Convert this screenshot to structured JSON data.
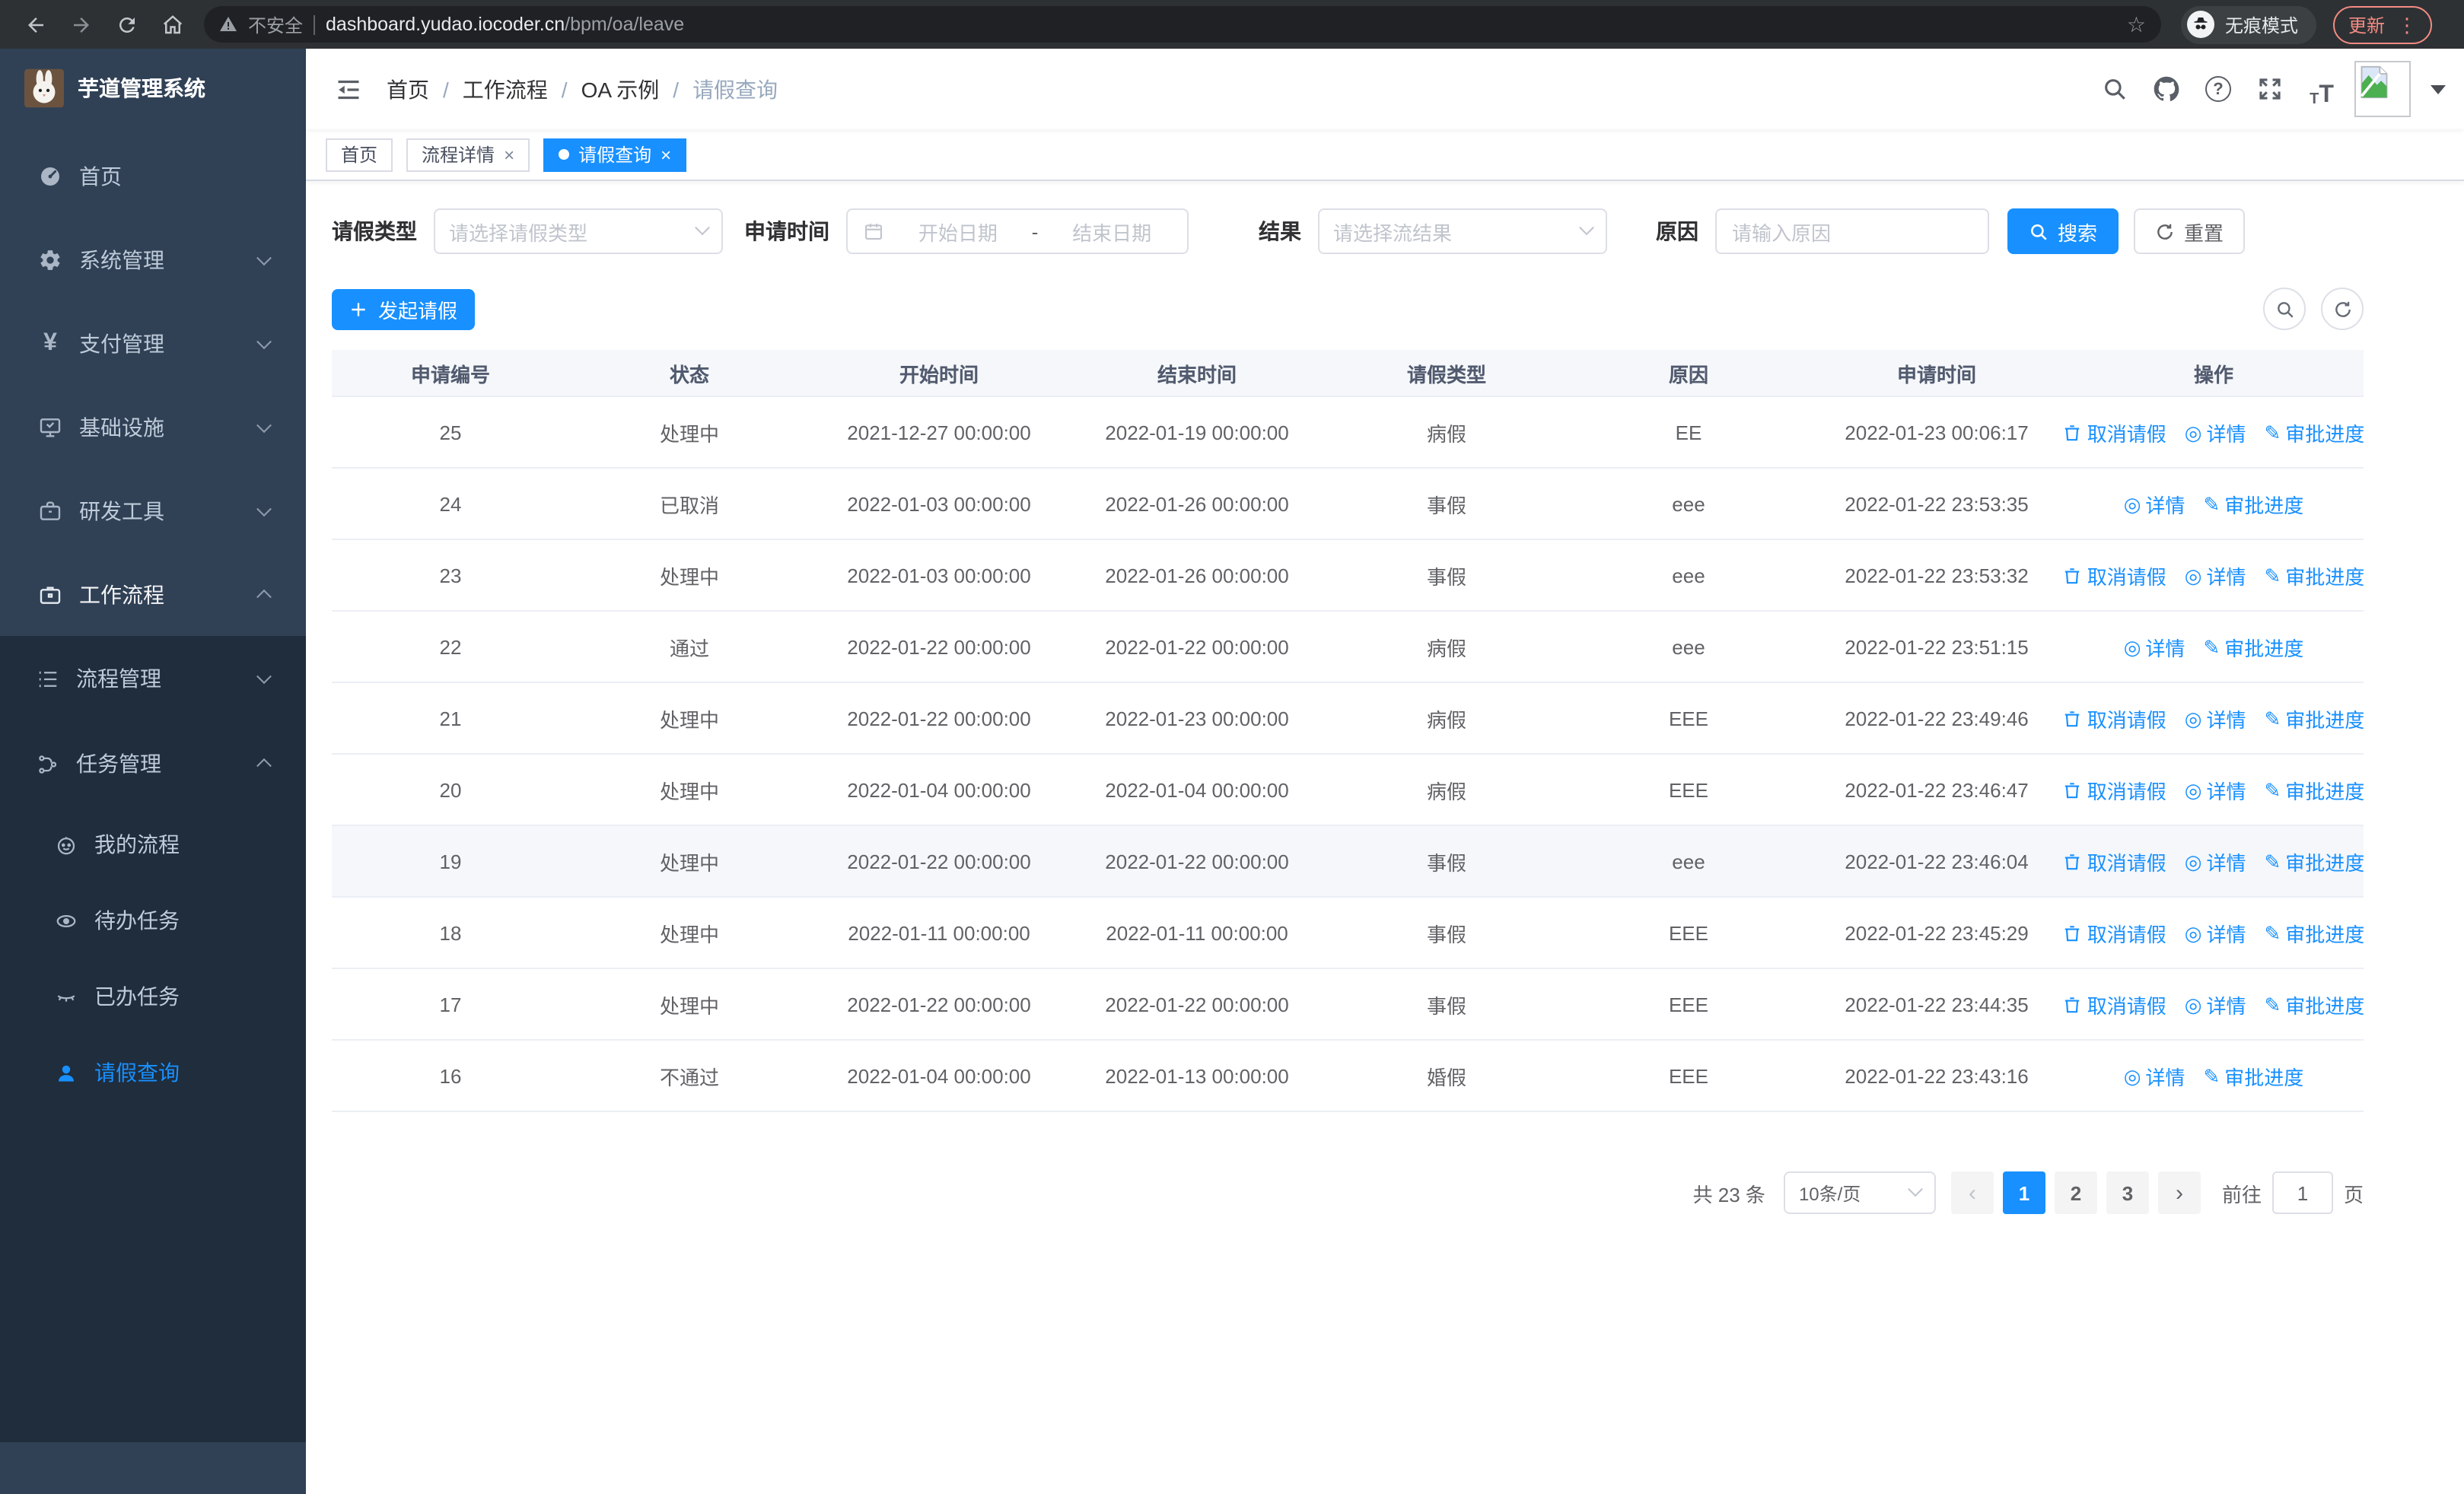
{
  "browser": {
    "security_label": "不安全",
    "url_domain": "dashboard.yudao.iocoder.cn",
    "url_path": "/bpm/oa/leave",
    "incognito_label": "无痕模式",
    "update_label": "更新"
  },
  "icons": {
    "star_glyph": "☆",
    "kebab_glyph": "⋮",
    "detail_glyph": "◎",
    "progress_glyph": "✎",
    "prev_glyph": "‹",
    "next_glyph": "›",
    "yen_glyph": "¥",
    "question_glyph": "?",
    "tt_small": "T",
    "tt_big": "T",
    "separator": "/",
    "close_glyph": "×",
    "date_separator": "-"
  },
  "sidebar": {
    "app_title": "芋道管理系统",
    "menu": [
      {
        "label": "首页",
        "icon": "dashboard-icon"
      },
      {
        "label": "系统管理",
        "icon": "gear-icon",
        "state": "collapsed"
      },
      {
        "label": "支付管理",
        "icon": "yen-icon",
        "state": "collapsed"
      },
      {
        "label": "基础设施",
        "icon": "monitor-icon",
        "state": "collapsed"
      },
      {
        "label": "研发工具",
        "icon": "toolbox-icon",
        "state": "collapsed"
      },
      {
        "label": "工作流程",
        "icon": "briefcase-icon",
        "state": "expanded",
        "active": true
      }
    ],
    "submenu": [
      {
        "label": "流程管理",
        "icon": "flow-list-icon",
        "state": "collapsed"
      },
      {
        "label": "任务管理",
        "icon": "tree-icon",
        "state": "expanded"
      }
    ],
    "task_items": [
      {
        "label": "我的流程",
        "icon": "robot-icon"
      },
      {
        "label": "待办任务",
        "icon": "eye-icon"
      },
      {
        "label": "已办任务",
        "icon": "eye-closed-icon"
      },
      {
        "label": "请假查询",
        "icon": "user-icon",
        "active": true
      }
    ]
  },
  "navbar": {
    "breadcrumb": [
      "首页",
      "工作流程",
      "OA 示例",
      "请假查询"
    ]
  },
  "tabs": [
    {
      "label": "首页"
    },
    {
      "label": "流程详情",
      "closable": true
    },
    {
      "label": "请假查询",
      "closable": true,
      "active": true
    }
  ],
  "filters": {
    "leave_type": {
      "label": "请假类型",
      "placeholder": "请选择请假类型"
    },
    "apply_time": {
      "label": "申请时间",
      "start_placeholder": "开始日期",
      "end_placeholder": "结束日期"
    },
    "result": {
      "label": "结果",
      "placeholder": "请选择流结果"
    },
    "reason": {
      "label": "原因",
      "placeholder": "请输入原因"
    },
    "search_label": "搜索",
    "reset_label": "重置"
  },
  "toolbar": {
    "create_label": "发起请假"
  },
  "table": {
    "columns": [
      "申请编号",
      "状态",
      "开始时间",
      "结束时间",
      "请假类型",
      "原因",
      "申请时间",
      "操作"
    ],
    "action_labels": {
      "cancel": "取消请假",
      "detail": "详情",
      "progress": "审批进度"
    },
    "rows": [
      {
        "id": "25",
        "status": "处理中",
        "start": "2021-12-27 00:00:00",
        "end": "2022-01-19 00:00:00",
        "type": "病假",
        "reason": "EE",
        "time": "2022-01-23 00:06:17"
      },
      {
        "id": "24",
        "status": "已取消",
        "start": "2022-01-03 00:00:00",
        "end": "2022-01-26 00:00:00",
        "type": "事假",
        "reason": "eee",
        "time": "2022-01-22 23:53:35"
      },
      {
        "id": "23",
        "status": "处理中",
        "start": "2022-01-03 00:00:00",
        "end": "2022-01-26 00:00:00",
        "type": "事假",
        "reason": "eee",
        "time": "2022-01-22 23:53:32"
      },
      {
        "id": "22",
        "status": "通过",
        "start": "2022-01-22 00:00:00",
        "end": "2022-01-22 00:00:00",
        "type": "病假",
        "reason": "eee",
        "time": "2022-01-22 23:51:15"
      },
      {
        "id": "21",
        "status": "处理中",
        "start": "2022-01-22 00:00:00",
        "end": "2022-01-23 00:00:00",
        "type": "病假",
        "reason": "EEE",
        "time": "2022-01-22 23:49:46"
      },
      {
        "id": "20",
        "status": "处理中",
        "start": "2022-01-04 00:00:00",
        "end": "2022-01-04 00:00:00",
        "type": "病假",
        "reason": "EEE",
        "time": "2022-01-22 23:46:47"
      },
      {
        "id": "19",
        "status": "处理中",
        "start": "2022-01-22 00:00:00",
        "end": "2022-01-22 00:00:00",
        "type": "事假",
        "reason": "eee",
        "time": "2022-01-22 23:46:04"
      },
      {
        "id": "18",
        "status": "处理中",
        "start": "2022-01-11 00:00:00",
        "end": "2022-01-11 00:00:00",
        "type": "事假",
        "reason": "EEE",
        "time": "2022-01-22 23:45:29"
      },
      {
        "id": "17",
        "status": "处理中",
        "start": "2022-01-22 00:00:00",
        "end": "2022-01-22 00:00:00",
        "type": "事假",
        "reason": "EEE",
        "time": "2022-01-22 23:44:35"
      },
      {
        "id": "16",
        "status": "不通过",
        "start": "2022-01-04 00:00:00",
        "end": "2022-01-13 00:00:00",
        "type": "婚假",
        "reason": "EEE",
        "time": "2022-01-22 23:43:16"
      }
    ]
  },
  "pagination": {
    "total_text": "共 23 条",
    "page_size": "10条/页",
    "pages": [
      "1",
      "2",
      "3"
    ],
    "active_page": "1",
    "goto_label": "前往",
    "goto_value": "1",
    "goto_unit": "页"
  },
  "colors": {
    "primary": "#1890ff",
    "sidebar_bg": "#304156",
    "submenu_bg": "#1f2d3d",
    "update_badge": "#f28b82"
  }
}
